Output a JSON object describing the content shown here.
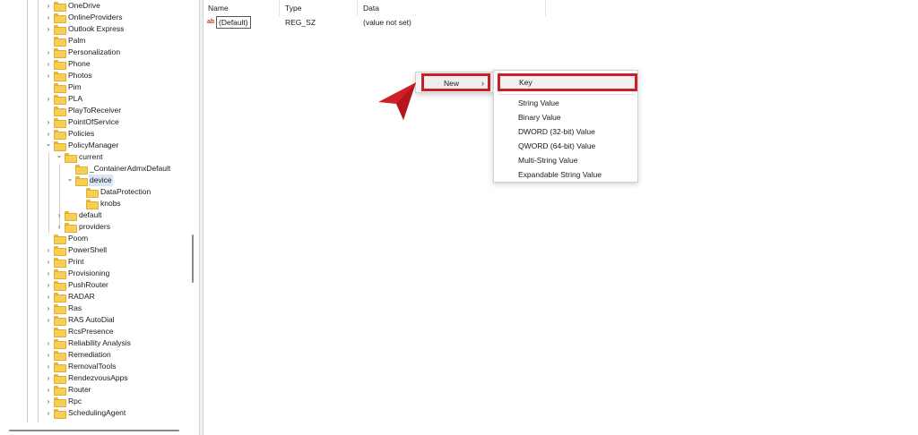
{
  "tree": {
    "items": [
      {
        "label": "OneDrive",
        "level": 0,
        "expander": "collapsed"
      },
      {
        "label": "OnlineProviders",
        "level": 0,
        "expander": "collapsed"
      },
      {
        "label": "Outlook Express",
        "level": 0,
        "expander": "collapsed"
      },
      {
        "label": "Palm",
        "level": 0,
        "expander": "none"
      },
      {
        "label": "Personalization",
        "level": 0,
        "expander": "collapsed"
      },
      {
        "label": "Phone",
        "level": 0,
        "expander": "collapsed"
      },
      {
        "label": "Photos",
        "level": 0,
        "expander": "collapsed"
      },
      {
        "label": "Pim",
        "level": 0,
        "expander": "none"
      },
      {
        "label": "PLA",
        "level": 0,
        "expander": "collapsed"
      },
      {
        "label": "PlayToReceiver",
        "level": 0,
        "expander": "none"
      },
      {
        "label": "PointOfService",
        "level": 0,
        "expander": "collapsed"
      },
      {
        "label": "Policies",
        "level": 0,
        "expander": "collapsed"
      },
      {
        "label": "PolicyManager",
        "level": 0,
        "expander": "expanded"
      },
      {
        "label": "current",
        "level": 1,
        "expander": "expanded"
      },
      {
        "label": "_ContainerAdmxDefault",
        "level": 2,
        "expander": "none"
      },
      {
        "label": "device",
        "level": 2,
        "expander": "expanded",
        "selected": true
      },
      {
        "label": "DataProtection",
        "level": 3,
        "expander": "none"
      },
      {
        "label": "knobs",
        "level": 3,
        "expander": "none"
      },
      {
        "label": "default",
        "level": 1,
        "expander": "collapsed"
      },
      {
        "label": "providers",
        "level": 1,
        "expander": "collapsed"
      },
      {
        "label": "Poom",
        "level": 0,
        "expander": "none"
      },
      {
        "label": "PowerShell",
        "level": 0,
        "expander": "collapsed"
      },
      {
        "label": "Print",
        "level": 0,
        "expander": "collapsed"
      },
      {
        "label": "Provisioning",
        "level": 0,
        "expander": "collapsed"
      },
      {
        "label": "PushRouter",
        "level": 0,
        "expander": "collapsed"
      },
      {
        "label": "RADAR",
        "level": 0,
        "expander": "collapsed"
      },
      {
        "label": "Ras",
        "level": 0,
        "expander": "collapsed"
      },
      {
        "label": "RAS AutoDial",
        "level": 0,
        "expander": "collapsed"
      },
      {
        "label": "RcsPresence",
        "level": 0,
        "expander": "none"
      },
      {
        "label": "Reliability Analysis",
        "level": 0,
        "expander": "collapsed"
      },
      {
        "label": "Remediation",
        "level": 0,
        "expander": "collapsed"
      },
      {
        "label": "RemovalTools",
        "level": 0,
        "expander": "collapsed"
      },
      {
        "label": "RendezvousApps",
        "level": 0,
        "expander": "collapsed"
      },
      {
        "label": "Router",
        "level": 0,
        "expander": "collapsed"
      },
      {
        "label": "Rpc",
        "level": 0,
        "expander": "collapsed"
      },
      {
        "label": "SchedulingAgent",
        "level": 0,
        "expander": "collapsed"
      }
    ]
  },
  "values": {
    "columns": {
      "name": "Name",
      "type": "Type",
      "data": "Data"
    },
    "rows": [
      {
        "icon": "ab",
        "name": "(Default)",
        "type": "REG_SZ",
        "data": "(value not set)"
      }
    ]
  },
  "context_menu": {
    "new_label": "New",
    "new_chevron": "›",
    "submenu": {
      "key": "Key",
      "items": [
        "String Value",
        "Binary Value",
        "DWORD (32-bit) Value",
        "QWORD (64-bit) Value",
        "Multi-String Value",
        "Expandable String Value"
      ]
    }
  },
  "colors": {
    "highlight": "#c8202a",
    "folder": "#f7cf55",
    "selection": "#d9e6f5"
  }
}
